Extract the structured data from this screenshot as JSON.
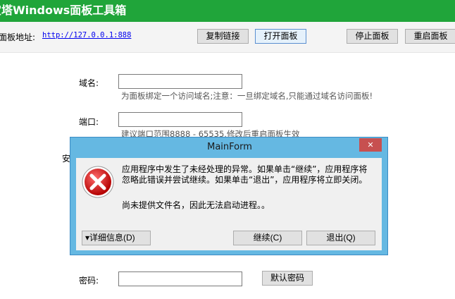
{
  "header": {
    "title": "宝塔Windows面板工具箱"
  },
  "toolbar": {
    "address_label": "面板地址:",
    "address_link": "http://127.0.0.1:888",
    "copy_link": "复制链接",
    "open_panel": "打开面板",
    "stop_panel": "停止面板",
    "restart_panel": "重启面板"
  },
  "form": {
    "domain_label": "域名:",
    "domain_hint": "为面板绑定一个访问域名;注意：一旦绑定域名,只能通过域名访问面板!",
    "port_label": "端口:",
    "port_hint": "建议端口范围8888 - 65535,修改后重启面板生效",
    "partial_label": "安",
    "password_label": "密码:",
    "default_password": "默认密码"
  },
  "dialog": {
    "title": "MainForm",
    "close": "✕",
    "message_1": "应用程序中发生了未经处理的异常。如果单击“继续”，应用程序将忽略此错误并尝试继续。如果单击“退出”，应用程序将立即关闭。",
    "message_2": "尚未提供文件名，因此无法启动进程。。",
    "details_button": "▾详细信息(D)",
    "continue_button": "继续(C)",
    "quit_button": "退出(Q)"
  },
  "colors": {
    "header_green": "#20a53a",
    "dialog_frame": "#65b8e2",
    "close_red": "#c75050"
  }
}
